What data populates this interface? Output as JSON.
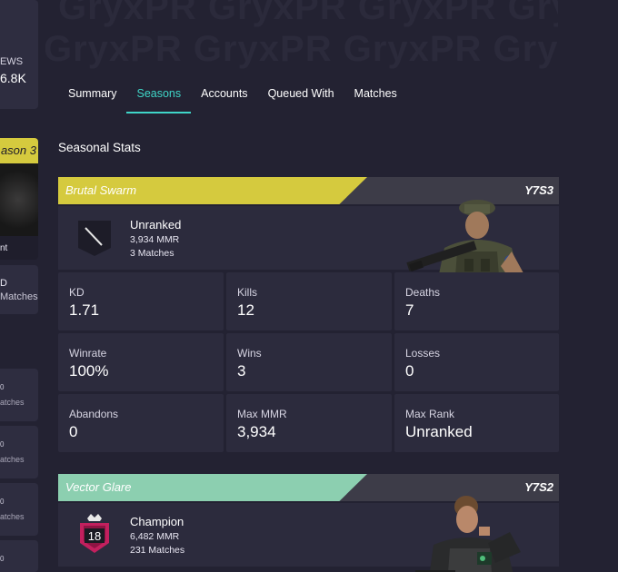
{
  "sidebar": {
    "views_label": "EWS",
    "views_value": "6.8K",
    "season_label": "ason 3",
    "season_rank": "nt",
    "kd_line1": "D",
    "kd_line2": "Matches",
    "small_cards": [
      {
        "l1": "0",
        "l2": "atches"
      },
      {
        "l1": "0",
        "l2": "atches"
      },
      {
        "l1": "0",
        "l2": "atches"
      },
      {
        "l1": "0",
        "l2": ""
      }
    ]
  },
  "hero": {
    "watermark_rows": [
      "GryxPR  GryxPR  GryxPR  GryxPR",
      "GryxPR  GryxPR  GryxPR  GryxPR"
    ]
  },
  "tabs": [
    {
      "label": "Summary",
      "active": false
    },
    {
      "label": "Seasons",
      "active": true
    },
    {
      "label": "Accounts",
      "active": false
    },
    {
      "label": "Queued With",
      "active": false
    },
    {
      "label": "Matches",
      "active": false
    }
  ],
  "section_title": "Seasonal Stats",
  "seasons": [
    {
      "name": "Brutal Swarm",
      "code": "Y7S3",
      "color": "#d5ca3e",
      "rank": "Unranked",
      "mmr": "3,934 MMR",
      "matches": "3 Matches",
      "stats": [
        {
          "label": "KD",
          "value": "1.71"
        },
        {
          "label": "Kills",
          "value": "12"
        },
        {
          "label": "Deaths",
          "value": "7"
        },
        {
          "label": "Winrate",
          "value": "100%"
        },
        {
          "label": "Wins",
          "value": "3"
        },
        {
          "label": "Losses",
          "value": "0"
        },
        {
          "label": "Abandons",
          "value": "0"
        },
        {
          "label": "Max MMR",
          "value": "3,934"
        },
        {
          "label": "Max Rank",
          "value": "Unranked"
        }
      ]
    },
    {
      "name": "Vector Glare",
      "code": "Y7S2",
      "color": "#8ccfb0",
      "rank": "Champion",
      "rank_number": "18",
      "mmr": "6,482 MMR",
      "matches": "231 Matches"
    }
  ],
  "colors": {
    "accent": "#3fd6c8",
    "background": "#232232",
    "card": "#2c2b3d",
    "champion": "#c3205e"
  }
}
